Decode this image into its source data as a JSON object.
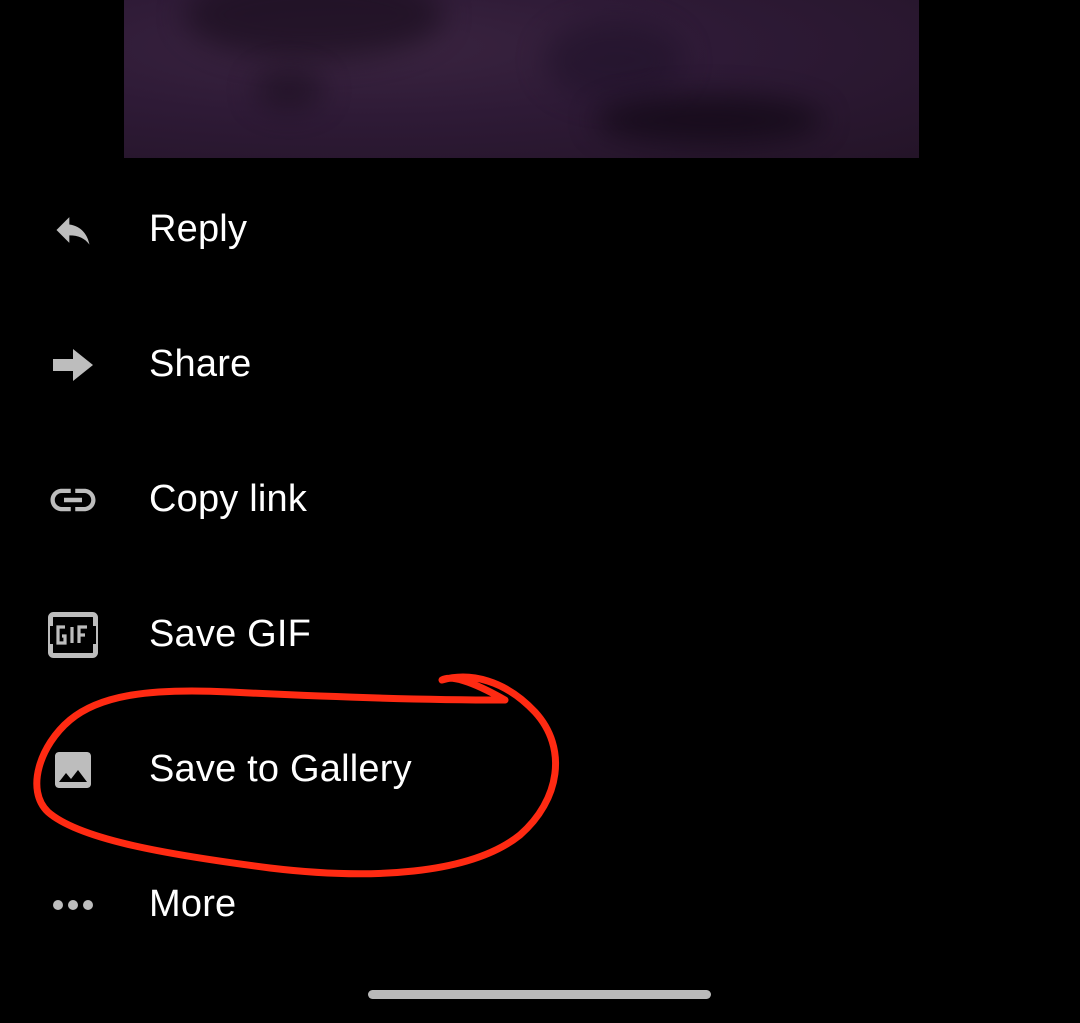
{
  "menu": {
    "items": [
      {
        "label": "Reply",
        "icon": "reply-icon"
      },
      {
        "label": "Share",
        "icon": "share-arrow-icon"
      },
      {
        "label": "Copy link",
        "icon": "link-icon"
      },
      {
        "label": "Save GIF",
        "icon": "gif-icon"
      },
      {
        "label": "Save to Gallery",
        "icon": "image-icon"
      },
      {
        "label": "More",
        "icon": "more-dots-icon"
      }
    ]
  },
  "annotation": {
    "color": "#ff2a12",
    "target": "Save to Gallery"
  },
  "colors": {
    "background": "#000000",
    "text": "#ffffff",
    "icon": "#bdbdbd"
  }
}
